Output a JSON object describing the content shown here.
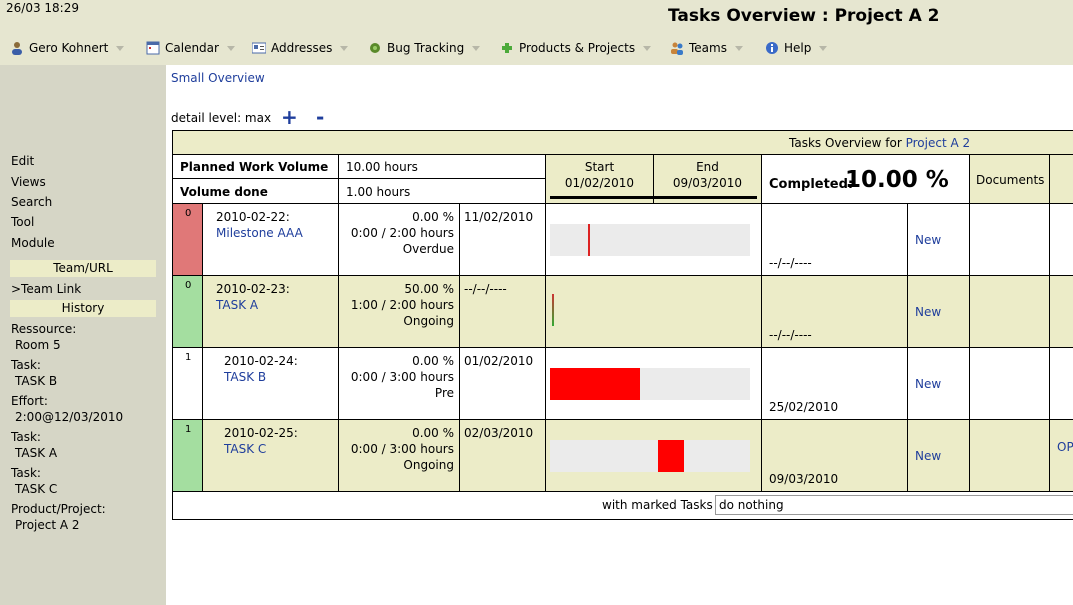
{
  "header": {
    "datetime": "26/03 18:29",
    "title": "Tasks Overview : Project A 2"
  },
  "menu": {
    "items": [
      {
        "label": "Gero Kohnert",
        "icon": "user-icon"
      },
      {
        "label": "Calendar",
        "icon": "calendar-icon"
      },
      {
        "label": "Addresses",
        "icon": "address-card-icon"
      },
      {
        "label": "Bug Tracking",
        "icon": "bug-icon"
      },
      {
        "label": "Products & Projects",
        "icon": "puzzle-icon"
      },
      {
        "label": "Teams",
        "icon": "team-icon"
      },
      {
        "label": "Help",
        "icon": "help-icon"
      }
    ]
  },
  "sidebar": {
    "links": [
      "Edit",
      "Views",
      "Search",
      "Tool",
      "Module"
    ],
    "team_url_header": "Team/URL",
    "team_link": ">Team Link",
    "history_header": "History",
    "history": [
      {
        "label": "Ressource:",
        "value": "Room 5"
      },
      {
        "label": "Task:",
        "value": "TASK B"
      },
      {
        "label": "Effort:",
        "value": "2:00@12/03/2010"
      },
      {
        "label": "Task:",
        "value": "TASK A"
      },
      {
        "label": "Task:",
        "value": "TASK C"
      },
      {
        "label": "Product/Project:",
        "value": "Project A 2"
      }
    ]
  },
  "content": {
    "small_overview": "Small Overview",
    "detail_level": "detail level: max",
    "plus": "+",
    "minus": "-",
    "table_title_prefix": "Tasks Overview for ",
    "table_title_project": "Project A 2",
    "planned_label": "Planned Work Volume",
    "planned_value": "10.00 hours",
    "done_label": "Volume done",
    "done_value": "1.00 hours",
    "start_label": "Start",
    "start_date": "01/02/2010",
    "end_label": "End",
    "end_date": "09/03/2010",
    "completed_label": "Completed:",
    "completed_value": "10.00 %",
    "documents_label": "Documents",
    "marked_label": "with marked Tasks",
    "marked_action": "do nothing",
    "rows": [
      {
        "prio": "0",
        "prio_color": "#e07878",
        "date": "2010-02-22:",
        "name": "Milestone AAA",
        "percent": "0.00 %",
        "hours": "0:00 / 2:00 hours",
        "status": "Overdue",
        "start": "11/02/2010",
        "end": "--/--/----",
        "new": "New",
        "bar_fill": 0.0,
        "bar_pos": 0.18,
        "bar_type": "marker"
      },
      {
        "prio": "0",
        "prio_color": "#a4dea0",
        "date": "2010-02-23:",
        "name": "TASK A",
        "percent": "50.00 %",
        "hours": "1:00 / 2:00 hours",
        "status": "Ongoing",
        "start": "--/--/----",
        "end": "--/--/----",
        "new": "New",
        "bar_fill": 0.0,
        "bar_pos": 0.0,
        "bar_type": "marker-green"
      },
      {
        "prio": "1",
        "prio_color": "#ffffff",
        "date": "2010-02-24:",
        "name": "TASK B",
        "percent": "0.00 %",
        "hours": "0:00 / 3:00 hours",
        "status": "Pre",
        "start": "01/02/2010",
        "end": "25/02/2010",
        "new": "New",
        "bar_fill": 0.45,
        "bar_pos": 0.0,
        "bar_type": "bar"
      },
      {
        "prio": "1",
        "prio_color": "#a4dea0",
        "date": "2010-02-25:",
        "name": "TASK C",
        "percent": "0.00 %",
        "hours": "0:00 / 3:00 hours",
        "status": "Ongoing",
        "start": "02/03/2010",
        "end": "09/03/2010",
        "new": "New",
        "bar_fill": 0.13,
        "bar_pos": 0.54,
        "bar_type": "bar",
        "extra": "OP"
      }
    ]
  },
  "colors": {
    "header_bg": "#e6e6d0",
    "sidebar_bg": "#d6d6c6",
    "tan": "#ececc8",
    "link": "#1f3e9c",
    "bar": "#ff0000"
  }
}
